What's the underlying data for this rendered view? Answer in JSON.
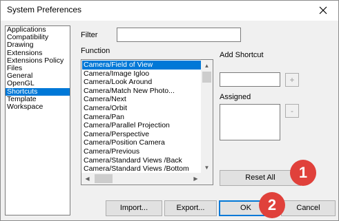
{
  "window": {
    "title": "System Preferences"
  },
  "panels": {
    "items": [
      "Applications",
      "Compatibility",
      "Drawing",
      "Extensions",
      "Extensions Policy",
      "Files",
      "General",
      "OpenGL",
      "Shortcuts",
      "Template",
      "Workspace"
    ],
    "selected": "Shortcuts"
  },
  "filter": {
    "label": "Filter",
    "value": ""
  },
  "function": {
    "label": "Function",
    "items": [
      "Camera/Field of View",
      "Camera/Image Igloo",
      "Camera/Look Around",
      "Camera/Match New Photo...",
      "Camera/Next",
      "Camera/Orbit",
      "Camera/Pan",
      "Camera/Parallel Projection",
      "Camera/Perspective",
      "Camera/Position Camera",
      "Camera/Previous",
      "Camera/Standard Views /Back",
      "Camera/Standard Views /Bottom"
    ],
    "selected": "Camera/Field of View"
  },
  "add_shortcut": {
    "label": "Add Shortcut",
    "value": "",
    "add_button": "+"
  },
  "assigned": {
    "label": "Assigned",
    "remove_button": "-"
  },
  "buttons": {
    "reset_all": "Reset All",
    "import": "Import...",
    "export": "Export...",
    "ok": "OK",
    "cancel": "Cancel"
  },
  "annotations": [
    "1",
    "2"
  ],
  "colors": {
    "selection": "#0078d7",
    "badge": "#e0413b"
  }
}
